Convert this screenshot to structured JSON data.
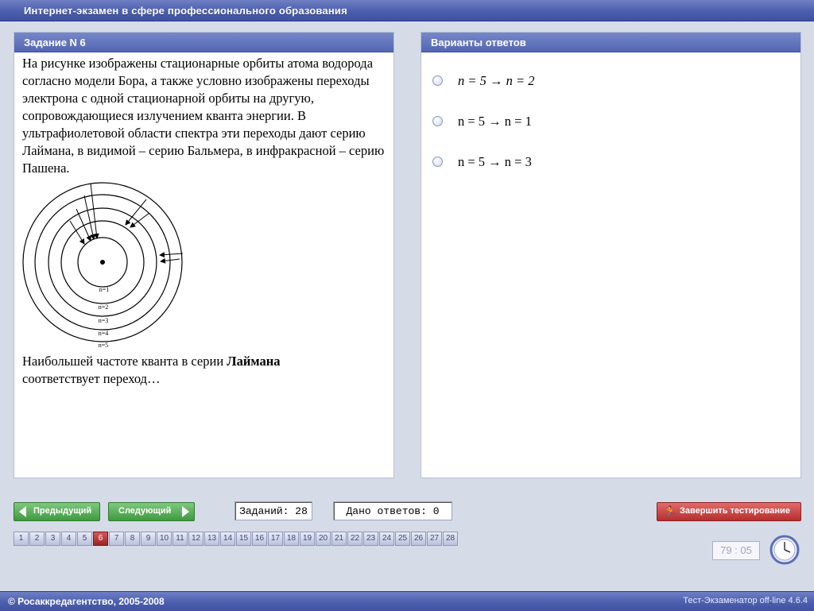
{
  "window": {
    "title": "Интернет-экзамен в сфере профессионального образования"
  },
  "task": {
    "header": "Задание N 6",
    "text": "На рисунке изображены стационарные орбиты атома водорода согласно модели Бора, а также условно изображены переходы электрона с одной стационарной орбиты на другую, сопровождающиеся излучением кванта энергии. В ультрафиолетовой области спектра эти переходы дают серию Лаймана, в видимой – серию Бальмера, в инфракрасной – серию Пашена.",
    "question_prefix": "Наибольшей частоте кванта в серии ",
    "question_bold": "Лаймана",
    "question_suffix": " соответствует переход…",
    "diagram_labels": [
      "n=1",
      "n=2",
      "n=3",
      "n=4",
      "n=5"
    ]
  },
  "answers": {
    "header": "Варианты ответов",
    "options": [
      "n = 5 → n = 2",
      "n = 5 → n = 1",
      "n = 5 → n = 3"
    ]
  },
  "nav": {
    "prev": "Предыдущий",
    "next": "Следующий",
    "tasks_count": "Заданий: 28",
    "answers_given": "Дано ответов: 0",
    "finish": "Завершить тестирование"
  },
  "pages": [
    "1",
    "2",
    "3",
    "4",
    "5",
    "6",
    "7",
    "8",
    "9",
    "10",
    "11",
    "12",
    "13",
    "14",
    "15",
    "16",
    "17",
    "18",
    "19",
    "20",
    "21",
    "22",
    "23",
    "24",
    "25",
    "26",
    "27",
    "28"
  ],
  "current_page": "6",
  "timer": "79 : 05",
  "footer": {
    "copyright": "© Росаккредагентство, 2005-2008",
    "version": "Тест-Экзаменатор off-line 4.6.4"
  }
}
